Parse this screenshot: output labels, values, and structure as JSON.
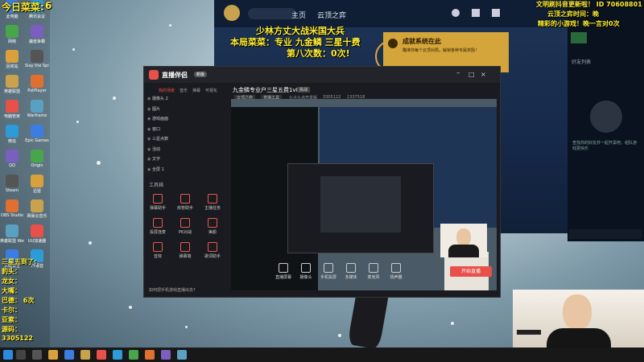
{
  "overlay": {
    "tl_title": "今日菜菜:",
    "tl_code": "6",
    "line1": "少林方丈大战米国大兵",
    "line2": "本局菜菜：专业 九金鳞 三星十费",
    "line3": "第八次数：0次!",
    "tr1": "文明刷抖音更新啦！ ID 70608801",
    "tr2": "云顶之弈时间：晚",
    "tr3": "精彩的小游戏！晚一言对0次"
  },
  "desktop_icons": [
    "此电脑",
    "网络",
    "回收站",
    "英雄联盟",
    "电脑管家",
    "微信",
    "QQ",
    "Steam",
    "OBS Studio",
    "英雄联盟 WeGame版",
    "火绒安全",
    "QQ音乐",
    "QQ游戏",
    "百度网盘",
    "WeGame",
    "腾讯会议",
    "魔兽争霸",
    "Slay the Spire",
    "PotPlayer",
    "Warframe",
    "Epic Games",
    "Origin",
    "迅雷",
    "网易云音乐",
    "UU加速器",
    "YY语音",
    "Discord",
    "英雄联盟 LOLM",
    "WPS Office",
    "B站直播姬"
  ],
  "game": {
    "nav": [
      "主页",
      "云顶之弈"
    ],
    "popup_title": "成就系统在此",
    "popup_text": "瞄准你每个云顶对局，解锁各种专属奖励！",
    "friends_label": "好友列表",
    "list_label": "查看玩家",
    "friend_note": "查找你的好友并一起开黑吧，组队游戏更快乐"
  },
  "capture": {
    "app": "直播伴侣",
    "badge": "新版",
    "tabs": [
      "我的场景",
      "音乐",
      "弹幕",
      "可视化"
    ],
    "scenes": [
      "摄像头 2",
      "图片",
      "游戏画面",
      "窗口",
      "三星点数",
      "活动",
      "文字",
      "全屏 1"
    ],
    "stream_title": "九金鳞专业户三星五费1v8!",
    "stream_tag": "挑战",
    "sub_tags": [
      "云顶之弈",
      "直播工具"
    ],
    "sub_meta": "九子九点开发版",
    "views": "3305122",
    "likes": "1337518",
    "tools_label": "工具箱",
    "tools": [
      "弹幕助手",
      "房管助手",
      "主播任务",
      "投屏连麦",
      "PK对战",
      "美颜",
      "音效",
      "弹幕墙",
      "歌词助手"
    ],
    "bottom": [
      "直播屏幕",
      "摄像头",
      "手机投屏",
      "多媒体",
      "麦克风",
      "扬声器"
    ],
    "notice": "如何把手机游戏直播出去?",
    "start_btn": "开始直播"
  },
  "stats_left": [
    "三星五到了:",
    "豹头：",
    "龙女：",
    "大嘴：",
    "巴德： 6次",
    "卡尔：",
    "亚索：",
    "源码：",
    "3305122"
  ],
  "colors": {
    "accent": "#e8504a",
    "gold": "#d4a53a",
    "overlay": "#ffee33"
  }
}
